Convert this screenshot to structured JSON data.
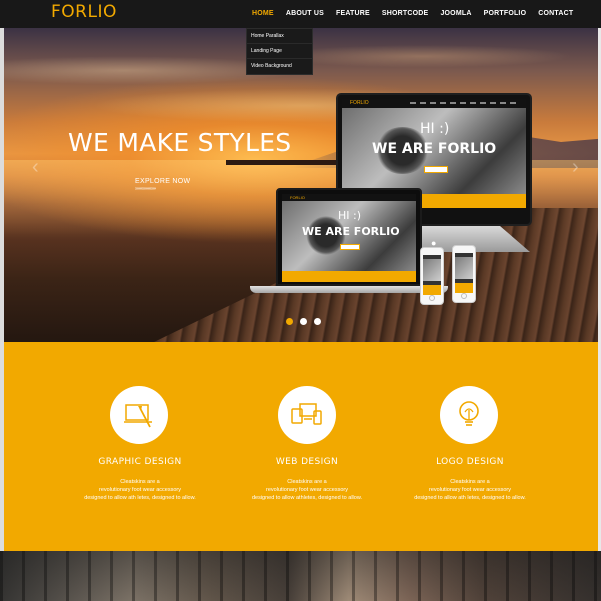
{
  "navbar": {
    "logo": "FORLIO",
    "items": [
      {
        "label": "HOME",
        "active": true
      },
      {
        "label": "ABOUT US",
        "active": false
      },
      {
        "label": "FEATURE",
        "active": false
      },
      {
        "label": "SHORTCODE",
        "active": false
      },
      {
        "label": "JOOMLA",
        "active": false
      },
      {
        "label": "PORTFOLIO",
        "active": false
      },
      {
        "label": "CONTACT",
        "active": false
      }
    ],
    "dropdown": [
      "Home Parallax",
      "Landing Page",
      "Video Background"
    ]
  },
  "hero": {
    "heading": "WE MAKE STYLES",
    "cta": "EXPLORE NOW",
    "cta_arrows": "»»»»»»»»»",
    "prev_icon": "chevron-left-icon",
    "next_icon": "chevron-right-icon",
    "device_screen": {
      "logo": "FORLIO",
      "hi": "HI :)",
      "title": "WE ARE FORLIO"
    },
    "slides": 3,
    "active_slide": 0
  },
  "services": [
    {
      "icon": "graphic-design-icon",
      "title": "GRAPHIC DESIGN",
      "lines": [
        "Cleatskins are a",
        "revolutionary foot wear accessory",
        "designed to allow ath letes, designed to allow."
      ]
    },
    {
      "icon": "web-design-icon",
      "title": "WEB DESIGN",
      "lines": [
        "Cleatskins are a",
        "revolutionary foot wear accessory",
        "designed to allow athletes, designed to allow."
      ]
    },
    {
      "icon": "logo-design-icon",
      "title": "LOGO DESIGN",
      "lines": [
        "Cleatskins are a",
        "revolutionary foot wear accessory",
        "designed to allow ath letes, designed to allow."
      ]
    }
  ],
  "colors": {
    "accent": "#f2a900",
    "navbar_bg": "#181818",
    "text_light": "#ffffff"
  }
}
